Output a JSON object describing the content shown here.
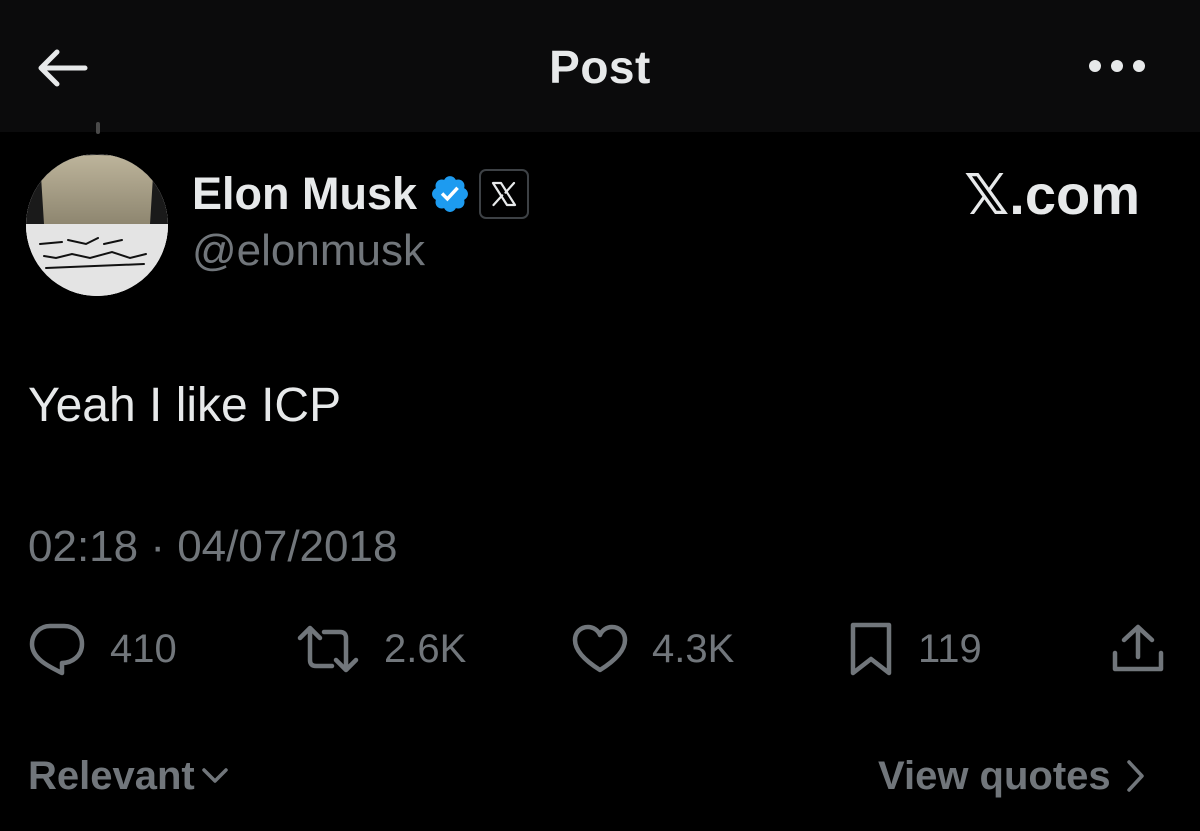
{
  "header": {
    "title": "Post",
    "back_icon": "arrow-left-icon",
    "more_icon": "more-horizontal-icon"
  },
  "author": {
    "name": "Elon Musk",
    "handle": "@elonmusk",
    "verified_color": "#1d9bf0",
    "affiliate_badge": "𝕏"
  },
  "source_label": "𝕏.com",
  "tweet": {
    "text": "Yeah I like ICP",
    "timestamp": "02:18 · 04/07/2018"
  },
  "actions": {
    "replies": "410",
    "reposts": "2.6K",
    "likes": "4.3K",
    "bookmarks": "119"
  },
  "footer": {
    "sort_label": "Relevant",
    "quotes_label": "View quotes"
  },
  "colors": {
    "background": "#000000",
    "header_background": "#0b0b0c",
    "primary_text": "#e7e9ea",
    "secondary_text": "#71767b",
    "verified": "#1d9bf0"
  }
}
